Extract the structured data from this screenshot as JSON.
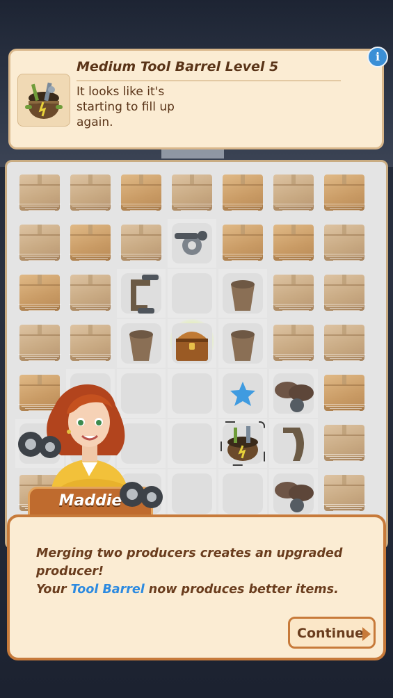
{
  "info_panel": {
    "title": "Medium Tool Barrel Level 5",
    "description": "It looks like it's starting to fill up again.",
    "icon": "tool-barrel-icon",
    "info_button_label": "i",
    "info_icon": "info-icon"
  },
  "board": {
    "cells": [
      [
        "box-light",
        "box-light",
        "box",
        "box-light",
        "box",
        "box-light",
        "box"
      ],
      [
        "box-light",
        "box",
        "box-light",
        "wrench-bolt",
        "box",
        "box",
        "box-light"
      ],
      [
        "box",
        "box-light",
        "clamp",
        "empty",
        "bucket",
        "box-light",
        "box-light"
      ],
      [
        "box-light",
        "box-light",
        "bucket",
        "chest",
        "bucket",
        "box-light",
        "box-light"
      ],
      [
        "box",
        "empty",
        "empty",
        "empty",
        "blue-star",
        "gloves",
        "box"
      ],
      [
        "wheels",
        "empty",
        "empty",
        "empty",
        "tool-barrel",
        "handle",
        "box-light"
      ],
      [
        "box-light",
        "empty",
        "wheels",
        "empty",
        "empty",
        "gloves",
        "box-light"
      ]
    ]
  },
  "character": {
    "name": "Maddie"
  },
  "dialog": {
    "line1": "Merging two producers creates an upgraded",
    "line2": "producer!",
    "line3_prefix": "Your ",
    "line3_highlight": "Tool Barrel",
    "line3_suffix": " now produces better items.",
    "continue_label": "Continue",
    "continue_icon": "chevron-right-icon"
  },
  "colors": {
    "panel_bg": "#fbecd3",
    "accent_orange": "#c77a3a",
    "text_brown": "#6a3d1e",
    "highlight_blue": "#2c8ae0",
    "info_blue": "#3b8fd6"
  }
}
